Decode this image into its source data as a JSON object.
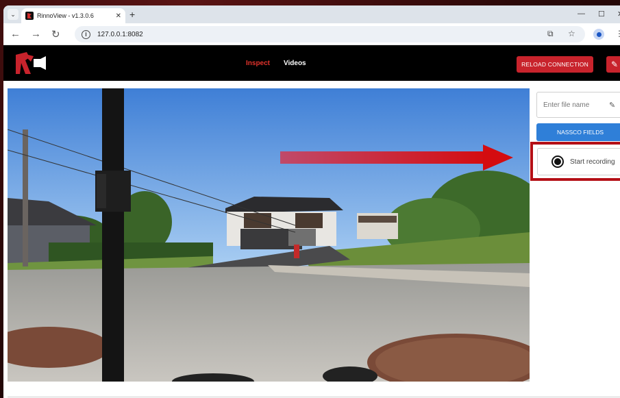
{
  "browser": {
    "tab_title": "RinnoView - v1.3.0.6",
    "url": "127.0.0.1:8082"
  },
  "nav": {
    "inspect": "Inspect",
    "videos": "Videos"
  },
  "header": {
    "reload_label": "RELOAD CONNECTION"
  },
  "sidebar": {
    "filename_placeholder": "Enter file name",
    "nassco_label": "NASSCO FIELDS",
    "record_label": "Start recording"
  },
  "colors": {
    "brand_red": "#c8232c",
    "nav_active": "#e2332c",
    "nassco_blue": "#2f7fd8",
    "header_bg": "#000000"
  }
}
